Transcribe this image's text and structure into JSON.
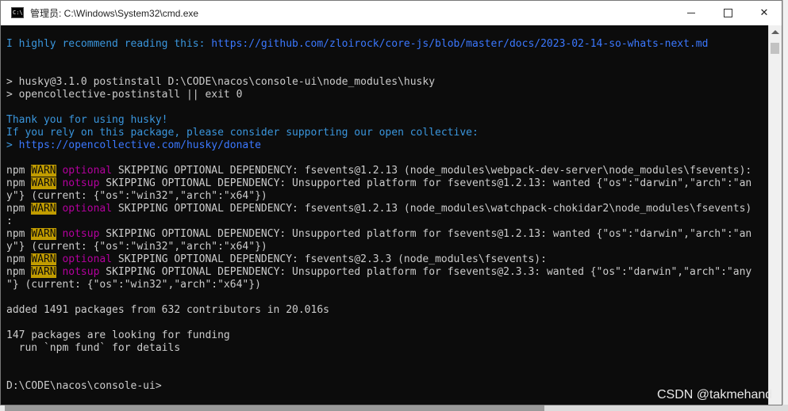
{
  "window": {
    "title": "管理员: C:\\Windows\\System32\\cmd.exe",
    "icon": "C:\\",
    "controls": {
      "minimize": "minimize-icon",
      "maximize": "maximize-icon",
      "close": "✕"
    }
  },
  "console": {
    "lines": [
      [
        {
          "t": "I highly recommend reading this: ",
          "c": "c-cyan"
        },
        {
          "t": "https://github.com/zloirock/core-js/blob/master/docs/2023-02-14-so-whats-next.md",
          "c": "c-blue"
        }
      ],
      [
        {
          "t": "",
          "c": "c-white"
        }
      ],
      [
        {
          "t": "",
          "c": "c-white"
        }
      ],
      [
        {
          "t": "> husky@3.1.0 postinstall D:\\CODE\\nacos\\console-ui\\node_modules\\husky",
          "c": "c-white"
        }
      ],
      [
        {
          "t": "> opencollective-postinstall || exit 0",
          "c": "c-white"
        }
      ],
      [
        {
          "t": "",
          "c": "c-white"
        }
      ],
      [
        {
          "t": "Thank you for using husky!",
          "c": "c-cyan"
        }
      ],
      [
        {
          "t": "If you rely on this package, please consider supporting our open collective:",
          "c": "c-cyan"
        }
      ],
      [
        {
          "t": "> ",
          "c": "c-cyan"
        },
        {
          "t": "https://opencollective.com/husky/donate",
          "c": "c-blue"
        }
      ],
      [
        {
          "t": "",
          "c": "c-white"
        }
      ],
      [
        {
          "t": "npm ",
          "c": "c-white"
        },
        {
          "t": "WARN",
          "c": "warn"
        },
        {
          "t": " ",
          "c": "c-white"
        },
        {
          "t": "optional",
          "c": "c-magenta"
        },
        {
          "t": " SKIPPING OPTIONAL DEPENDENCY: fsevents@1.2.13 (node_modules\\webpack-dev-server\\node_modules\\fsevents):",
          "c": "c-white"
        }
      ],
      [
        {
          "t": "npm ",
          "c": "c-white"
        },
        {
          "t": "WARN",
          "c": "warn"
        },
        {
          "t": " ",
          "c": "c-white"
        },
        {
          "t": "notsup",
          "c": "c-magenta"
        },
        {
          "t": " SKIPPING OPTIONAL DEPENDENCY: Unsupported platform for fsevents@1.2.13: wanted {\"os\":\"darwin\",\"arch\":\"an",
          "c": "c-white"
        }
      ],
      [
        {
          "t": "y\"} (current: {\"os\":\"win32\",\"arch\":\"x64\"})",
          "c": "c-white"
        }
      ],
      [
        {
          "t": "npm ",
          "c": "c-white"
        },
        {
          "t": "WARN",
          "c": "warn"
        },
        {
          "t": " ",
          "c": "c-white"
        },
        {
          "t": "optional",
          "c": "c-magenta"
        },
        {
          "t": " SKIPPING OPTIONAL DEPENDENCY: fsevents@1.2.13 (node_modules\\watchpack-chokidar2\\node_modules\\fsevents)",
          "c": "c-white"
        }
      ],
      [
        {
          "t": ":",
          "c": "c-white"
        }
      ],
      [
        {
          "t": "npm ",
          "c": "c-white"
        },
        {
          "t": "WARN",
          "c": "warn"
        },
        {
          "t": " ",
          "c": "c-white"
        },
        {
          "t": "notsup",
          "c": "c-magenta"
        },
        {
          "t": " SKIPPING OPTIONAL DEPENDENCY: Unsupported platform for fsevents@1.2.13: wanted {\"os\":\"darwin\",\"arch\":\"an",
          "c": "c-white"
        }
      ],
      [
        {
          "t": "y\"} (current: {\"os\":\"win32\",\"arch\":\"x64\"})",
          "c": "c-white"
        }
      ],
      [
        {
          "t": "npm ",
          "c": "c-white"
        },
        {
          "t": "WARN",
          "c": "warn"
        },
        {
          "t": " ",
          "c": "c-white"
        },
        {
          "t": "optional",
          "c": "c-magenta"
        },
        {
          "t": " SKIPPING OPTIONAL DEPENDENCY: fsevents@2.3.3 (node_modules\\fsevents):",
          "c": "c-white"
        }
      ],
      [
        {
          "t": "npm ",
          "c": "c-white"
        },
        {
          "t": "WARN",
          "c": "warn"
        },
        {
          "t": " ",
          "c": "c-white"
        },
        {
          "t": "notsup",
          "c": "c-magenta"
        },
        {
          "t": " SKIPPING OPTIONAL DEPENDENCY: Unsupported platform for fsevents@2.3.3: wanted {\"os\":\"darwin\",\"arch\":\"any",
          "c": "c-white"
        }
      ],
      [
        {
          "t": "\"} (current: {\"os\":\"win32\",\"arch\":\"x64\"})",
          "c": "c-white"
        }
      ],
      [
        {
          "t": "",
          "c": "c-white"
        }
      ],
      [
        {
          "t": "added 1491 packages from 632 contributors in 20.016s",
          "c": "c-white"
        }
      ],
      [
        {
          "t": "",
          "c": "c-white"
        }
      ],
      [
        {
          "t": "147 packages are looking for funding",
          "c": "c-white"
        }
      ],
      [
        {
          "t": "  run `npm fund` for details",
          "c": "c-white"
        }
      ],
      [
        {
          "t": "",
          "c": "c-white"
        }
      ],
      [
        {
          "t": "",
          "c": "c-white"
        }
      ],
      [
        {
          "t": "D:\\CODE\\nacos\\console-ui>",
          "c": "c-white"
        }
      ]
    ]
  },
  "watermark": "CSDN @takmehand",
  "colors": {
    "console_bg": "#0c0c0c",
    "text": "#cccccc",
    "cyan": "#3a96dd",
    "link_blue": "#3b78ff",
    "warn_bg": "#c19c00",
    "magenta": "#b4009e"
  }
}
